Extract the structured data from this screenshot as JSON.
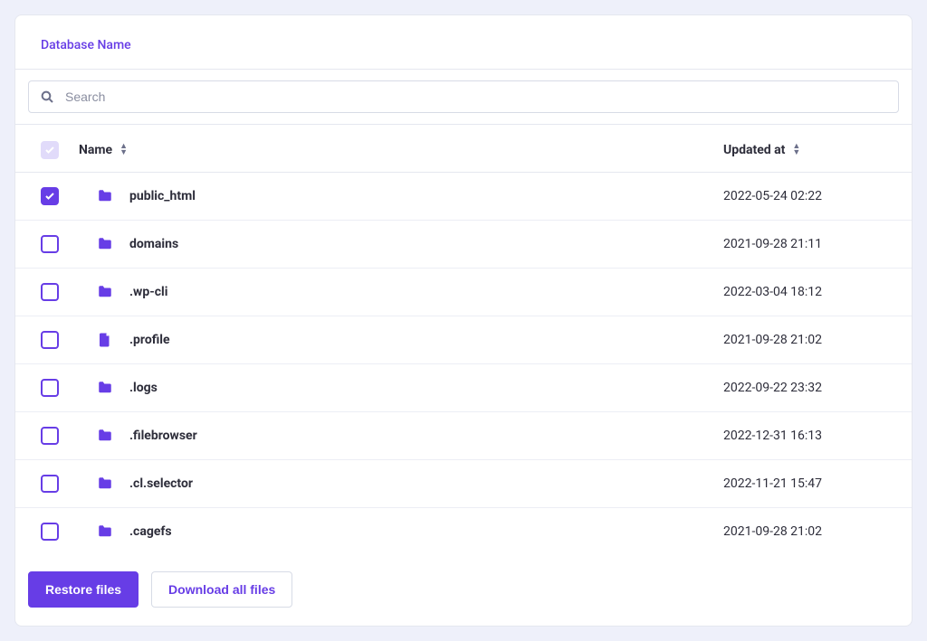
{
  "header": {
    "title": "Database Name"
  },
  "search": {
    "placeholder": "Search"
  },
  "columns": {
    "name": "Name",
    "updated": "Updated at"
  },
  "files": [
    {
      "name": "public_html",
      "type": "folder",
      "updated": "2022-05-24 02:22",
      "checked": true
    },
    {
      "name": "domains",
      "type": "folder",
      "updated": "2021-09-28 21:11",
      "checked": false
    },
    {
      "name": ".wp-cli",
      "type": "folder",
      "updated": "2022-03-04 18:12",
      "checked": false
    },
    {
      "name": ".profile",
      "type": "file",
      "updated": "2021-09-28 21:02",
      "checked": false
    },
    {
      "name": ".logs",
      "type": "folder",
      "updated": "2022-09-22 23:32",
      "checked": false
    },
    {
      "name": ".filebrowser",
      "type": "folder",
      "updated": "2022-12-31 16:13",
      "checked": false
    },
    {
      "name": ".cl.selector",
      "type": "folder",
      "updated": "2022-11-21 15:47",
      "checked": false
    },
    {
      "name": ".cagefs",
      "type": "folder",
      "updated": "2021-09-28 21:02",
      "checked": false
    }
  ],
  "actions": {
    "restore": "Restore files",
    "download": "Download all files"
  }
}
